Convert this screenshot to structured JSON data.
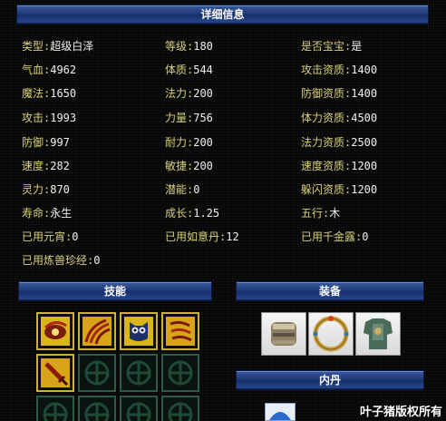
{
  "header": {
    "title": "详细信息"
  },
  "attributes": [
    {
      "label": "类型:",
      "value": "超级白泽"
    },
    {
      "label": "等级:",
      "value": "180"
    },
    {
      "label": "是否宝宝:",
      "value": "是"
    },
    {
      "label": "气血:",
      "value": "4962"
    },
    {
      "label": "体质:",
      "value": "544"
    },
    {
      "label": "攻击资质:",
      "value": "1400"
    },
    {
      "label": "魔法:",
      "value": "1650"
    },
    {
      "label": "法力:",
      "value": "200"
    },
    {
      "label": "防御资质:",
      "value": "1400"
    },
    {
      "label": "攻击:",
      "value": "1993"
    },
    {
      "label": "力量:",
      "value": "756"
    },
    {
      "label": "体力资质:",
      "value": "4500"
    },
    {
      "label": "防御:",
      "value": "997"
    },
    {
      "label": "耐力:",
      "value": "200"
    },
    {
      "label": "法力资质:",
      "value": "2500"
    },
    {
      "label": "速度:",
      "value": "282"
    },
    {
      "label": "敏捷:",
      "value": "200"
    },
    {
      "label": "速度资质:",
      "value": "1200"
    },
    {
      "label": "灵力:",
      "value": "870"
    },
    {
      "label": "潜能:",
      "value": "0"
    },
    {
      "label": "躲闪资质:",
      "value": "1200"
    },
    {
      "label": "寿命:",
      "value": "永生"
    },
    {
      "label": "成长:",
      "value": "1.25"
    },
    {
      "label": "五行:",
      "value": "木"
    },
    {
      "label": "已用元宵:",
      "value": "0"
    },
    {
      "label": "已用如意丹:",
      "value": "12"
    },
    {
      "label": "已用千金露:",
      "value": "0"
    },
    {
      "label": "已用炼兽珍经:",
      "value": "0"
    }
  ],
  "skills_panel": {
    "title": "技能",
    "slots": [
      {
        "icon": "eye-skill-icon",
        "filled": true
      },
      {
        "icon": "claw-skill-icon",
        "filled": true
      },
      {
        "icon": "owl-skill-icon",
        "filled": true
      },
      {
        "icon": "wave-skill-icon",
        "filled": true
      },
      {
        "icon": "sword-skill-icon",
        "filled": true
      },
      {
        "icon": "empty-slot-icon",
        "filled": false
      },
      {
        "icon": "empty-slot-icon",
        "filled": false
      },
      {
        "icon": "empty-slot-icon",
        "filled": false
      },
      {
        "icon": "empty-slot-icon",
        "filled": false
      },
      {
        "icon": "empty-slot-icon",
        "filled": false
      },
      {
        "icon": "empty-slot-icon",
        "filled": false
      },
      {
        "icon": "empty-slot-icon",
        "filled": false
      }
    ]
  },
  "equipment_panel": {
    "title": "装备",
    "items": [
      {
        "icon": "bracer-icon"
      },
      {
        "icon": "ring-icon"
      },
      {
        "icon": "armor-icon"
      }
    ]
  },
  "inner_pill_panel": {
    "title": "内丹"
  },
  "watermark": "叶子猪版权所有",
  "colors": {
    "label": "#d7d07a",
    "value": "#f0f0f0",
    "title_bar": "#1f3a7a",
    "slot_border_filled": "#c9b13c",
    "slot_border_empty": "#2f5a45"
  }
}
